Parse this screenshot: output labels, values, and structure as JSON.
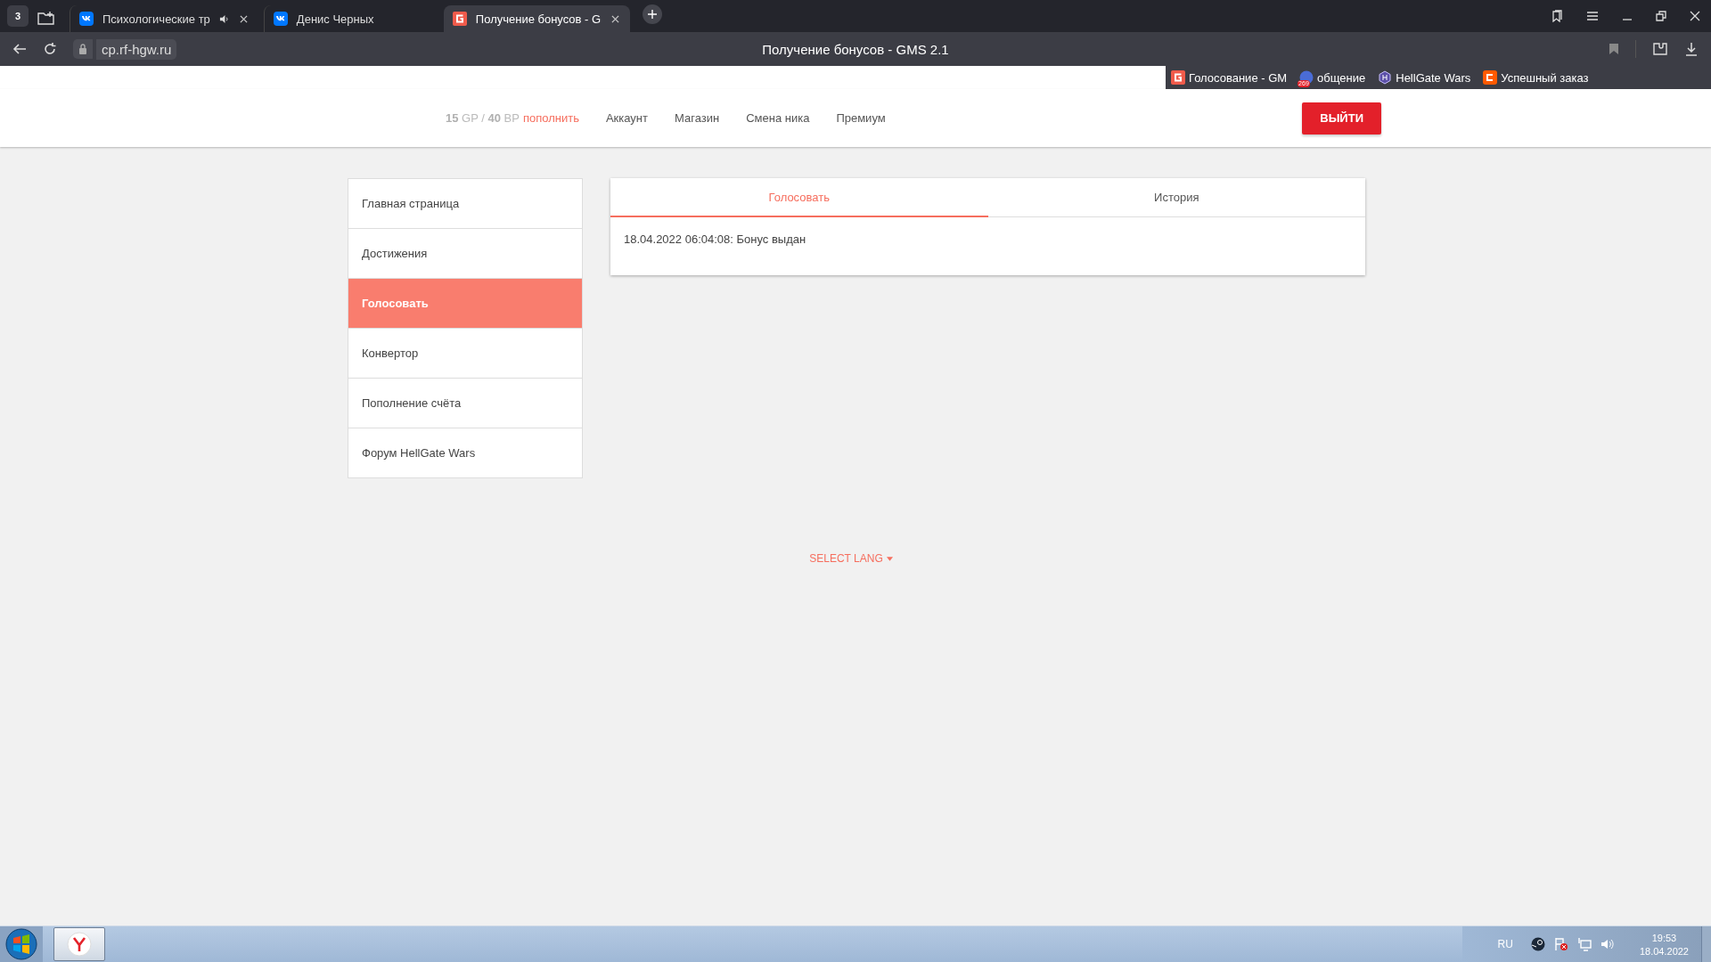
{
  "browser": {
    "tab_counter": "3",
    "tabs": [
      {
        "title": "Психологические тр",
        "audio": true,
        "closable": true,
        "selected": false
      },
      {
        "title": "Денис Черных",
        "audio": false,
        "closable": false,
        "selected": false
      },
      {
        "title": "Получение бонусов - G",
        "audio": false,
        "closable": true,
        "selected": true
      }
    ],
    "url": "cp.rf-hgw.ru",
    "page_title": "Получение бонусов - GMS 2.1",
    "bookmarks": [
      {
        "label": "Голосование - GM"
      },
      {
        "label": "общение",
        "badge": "269"
      },
      {
        "label": "HellGate Wars"
      },
      {
        "label": "Успешный заказ"
      }
    ]
  },
  "header": {
    "balance": "**15** GP / **40** BP",
    "top_up": "пополнить",
    "links": [
      "Аккаунт",
      "Магазин",
      "Смена ника",
      "Премиум"
    ],
    "logout": "ВЫЙТИ"
  },
  "sidebar": {
    "items": [
      {
        "label": "Главная страница",
        "selected": false
      },
      {
        "label": "Достижения",
        "selected": false
      },
      {
        "label": "Голосовать",
        "selected": true
      },
      {
        "label": "Конвертор",
        "selected": false
      },
      {
        "label": "Пополнение счёта",
        "selected": false
      },
      {
        "label": "Форум HellGate Wars",
        "selected": false
      }
    ]
  },
  "panel": {
    "tabs": [
      {
        "label": "Голосовать",
        "selected": true
      },
      {
        "label": "История",
        "selected": false
      }
    ],
    "entries": [
      "18.04.2022 06:04:08: Бонус выдан"
    ]
  },
  "footer": {
    "select_lang": "SELECT LANG"
  },
  "taskbar": {
    "language": "RU",
    "time": "19:53",
    "date": "18.04.2022"
  }
}
